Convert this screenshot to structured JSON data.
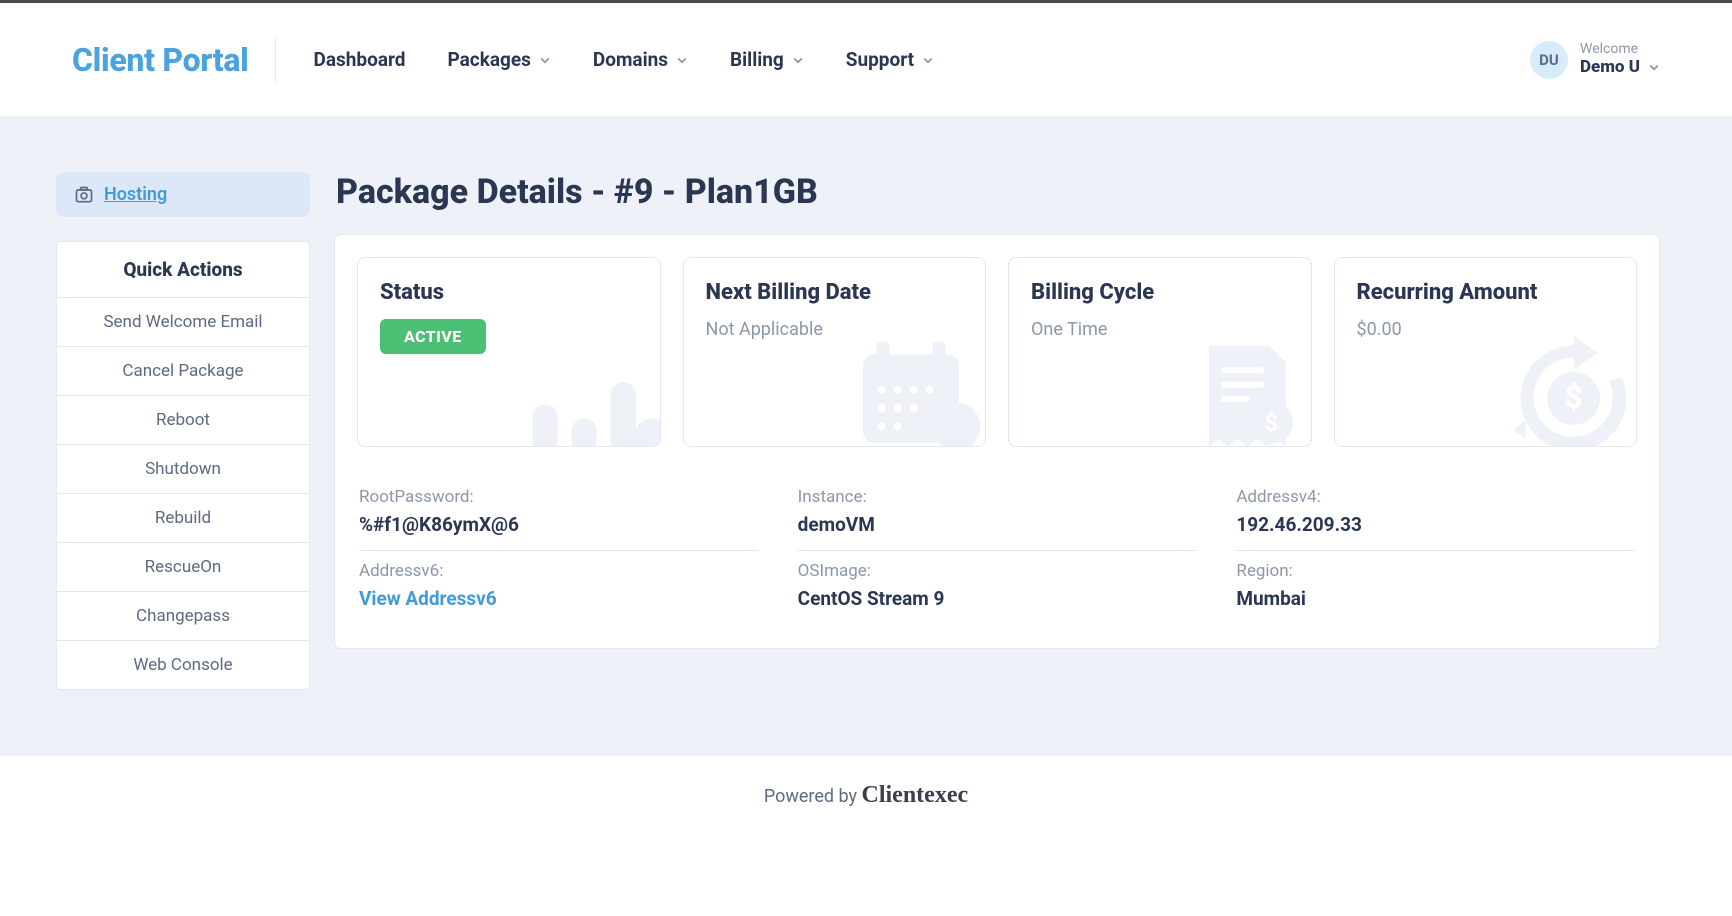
{
  "brand": "Client Portal",
  "nav": {
    "dashboard": "Dashboard",
    "packages": "Packages",
    "domains": "Domains",
    "billing": "Billing",
    "support": "Support"
  },
  "user": {
    "welcome": "Welcome",
    "name": "Demo U",
    "initials": "DU"
  },
  "sidebar": {
    "hosting": "Hosting",
    "quick_actions_title": "Quick Actions",
    "actions": [
      "Send Welcome Email",
      "Cancel Package",
      "Reboot",
      "Shutdown",
      "Rebuild",
      "RescueOn",
      "Changepass",
      "Web Console"
    ]
  },
  "page_title": "Package Details - #9 - Plan1GB",
  "cards": {
    "status": {
      "label": "Status",
      "value": "ACTIVE"
    },
    "next_billing": {
      "label": "Next Billing Date",
      "value": "Not Applicable"
    },
    "cycle": {
      "label": "Billing Cycle",
      "value": "One Time"
    },
    "recurring": {
      "label": "Recurring Amount",
      "value": "$0.00"
    }
  },
  "details": {
    "root_password": {
      "k": "RootPassword:",
      "v": "%#f1@K86ymX@6"
    },
    "instance": {
      "k": "Instance:",
      "v": "demoVM"
    },
    "addressv4": {
      "k": "Addressv4:",
      "v": "192.46.209.33"
    },
    "addressv6": {
      "k": "Addressv6:",
      "v": "View Addressv6"
    },
    "osimage": {
      "k": "OSImage:",
      "v": "CentOS Stream 9"
    },
    "region": {
      "k": "Region:",
      "v": "Mumbai"
    }
  },
  "footer": {
    "powered_by": "Powered by ",
    "brand": "Clientexec"
  }
}
